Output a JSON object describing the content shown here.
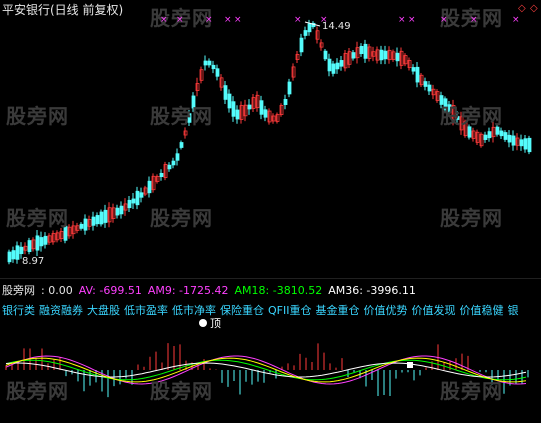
{
  "title": "平安银行(日线 前复权)",
  "watermark": "股旁网",
  "high_label": "14.49",
  "low_label": "8.97",
  "lower_panel": {
    "name": "股旁网",
    "value": ": 0.00",
    "av": "AV: -699.51",
    "am9": "AM9: -1725.42",
    "am18": "AM18: -3810.52",
    "am36": "AM36: -3996.11",
    "tags": [
      "银行类",
      "融资融券",
      "大盘股",
      "低市盈率",
      "低市净率",
      "保险重仓",
      "QFII重仓",
      "基金重仓",
      "价值优势",
      "价值发现",
      "价值稳健",
      "银"
    ],
    "ding_label": "顶"
  },
  "colors": {
    "up": "#ff3a3a",
    "down": "#54fcfc",
    "av": "#ff40ff",
    "am9": "#ff40ff",
    "am18": "#00ff00",
    "am36": "#ffffff",
    "tag": "#3ad6ff",
    "marker": "#ff40ff"
  },
  "icons": {
    "top_marker": "x-mark-icon",
    "corner_marker": "diamond-icon"
  }
}
